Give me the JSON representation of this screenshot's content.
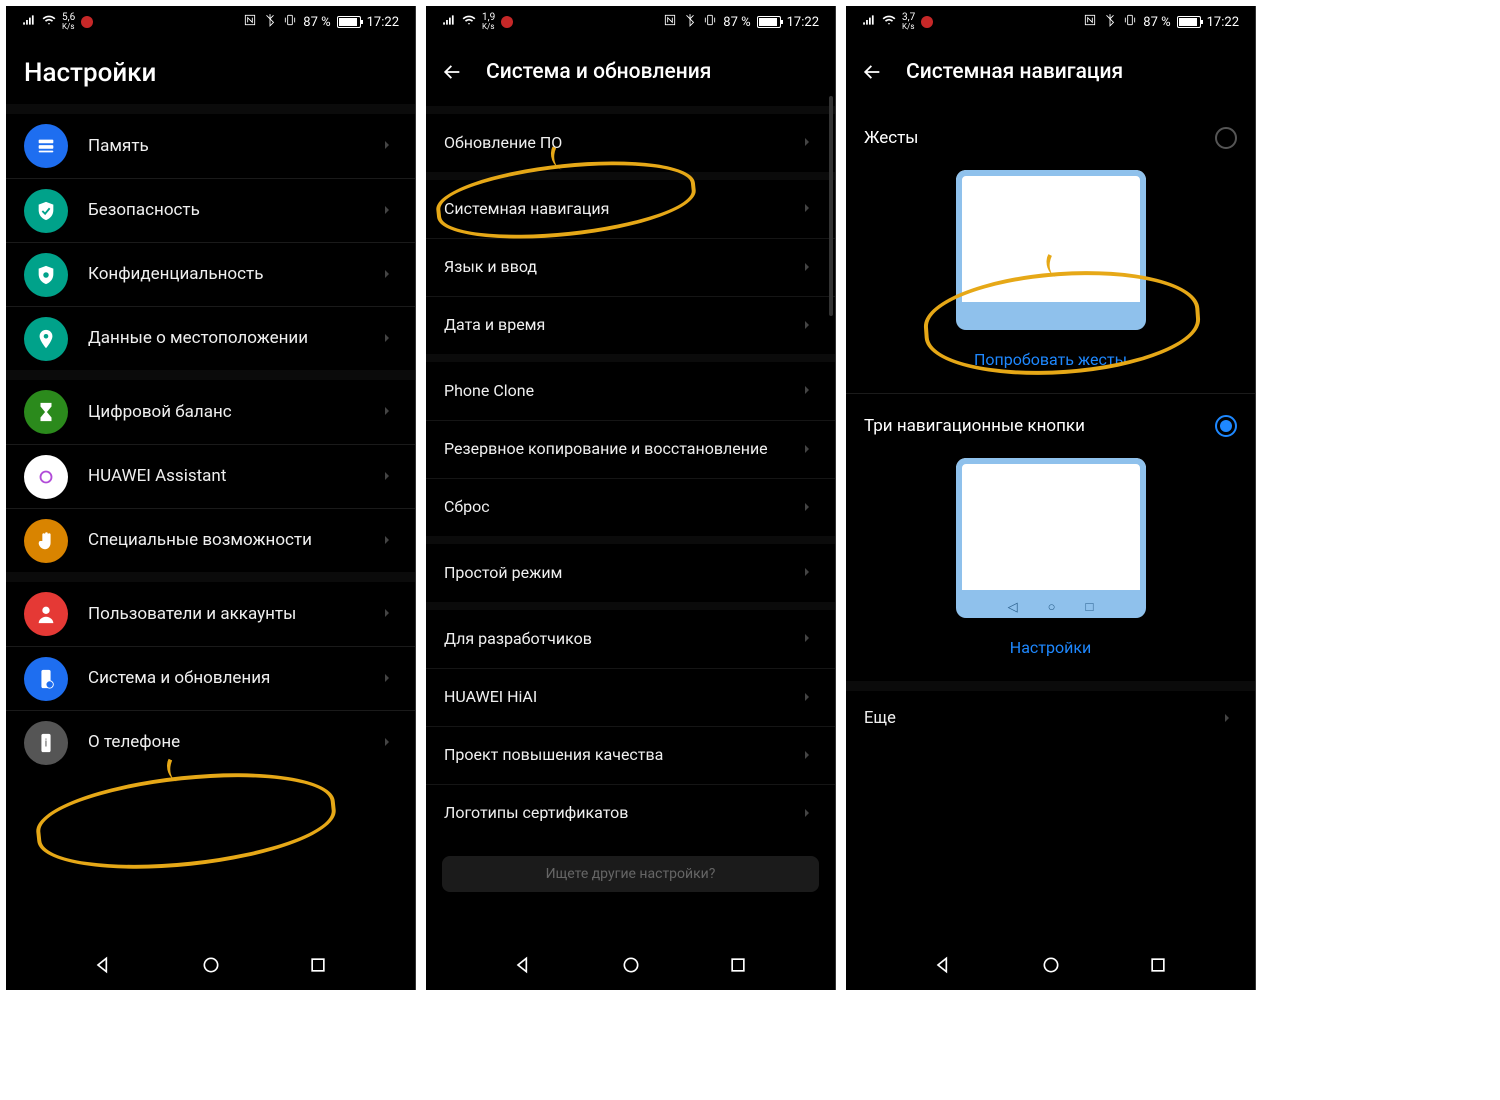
{
  "panels": [
    {
      "status": {
        "speed": "5,6",
        "unit": "K/s",
        "battery_pct": "87 %",
        "time": "17:22"
      },
      "title": "Настройки",
      "groups": [
        [
          {
            "icon": "storage",
            "color": "#1e6ef0",
            "label": "Память"
          },
          {
            "icon": "shield-check",
            "color": "#00a28a",
            "label": "Безопасность"
          },
          {
            "icon": "shield-lock",
            "color": "#00a28a",
            "label": "Конфиденциальность"
          },
          {
            "icon": "pin",
            "color": "#00a28a",
            "label": "Данные о местоположении"
          }
        ],
        [
          {
            "icon": "hourglass",
            "color": "#2b8a1c",
            "label": "Цифровой баланс"
          },
          {
            "icon": "assistant",
            "color": "#ffffff",
            "label": "HUAWEI Assistant"
          },
          {
            "icon": "hand",
            "color": "#d98400",
            "label": "Специальные возможности"
          }
        ],
        [
          {
            "icon": "user",
            "color": "#e53935",
            "label": "Пользователи и аккаунты"
          },
          {
            "icon": "phone-gear",
            "color": "#1e6ef0",
            "label": "Система и обновления"
          },
          {
            "icon": "info",
            "color": "#555555",
            "label": "О телефоне"
          }
        ]
      ]
    },
    {
      "status": {
        "speed": "1,9",
        "unit": "K/s",
        "battery_pct": "87 %",
        "time": "17:22"
      },
      "title": "Система и обновления",
      "groups": [
        [
          {
            "label": "Обновление ПО"
          }
        ],
        [
          {
            "label": "Системная навигация"
          },
          {
            "label": "Язык и ввод"
          },
          {
            "label": "Дата и время"
          }
        ],
        [
          {
            "label": "Phone Clone"
          },
          {
            "label": "Резервное копирование и восстановление"
          },
          {
            "label": "Сброс"
          }
        ],
        [
          {
            "label": "Простой режим"
          }
        ],
        [
          {
            "label": "Для разработчиков"
          },
          {
            "label": "HUAWEI HiAI"
          },
          {
            "label": "Проект повышения качества"
          },
          {
            "label": "Логотипы сертификатов"
          }
        ]
      ],
      "footer_search": "Ищете другие настройки?"
    },
    {
      "status": {
        "speed": "3,7",
        "unit": "K/s",
        "battery_pct": "87 %",
        "time": "17:22"
      },
      "title": "Системная навигация",
      "option_gestures": {
        "label": "Жесты",
        "action": "Попробовать жесты",
        "selected": false
      },
      "option_three_btn": {
        "label": "Три навигационные кнопки",
        "action": "Настройки",
        "selected": true
      },
      "more_label": "Еще"
    }
  ]
}
